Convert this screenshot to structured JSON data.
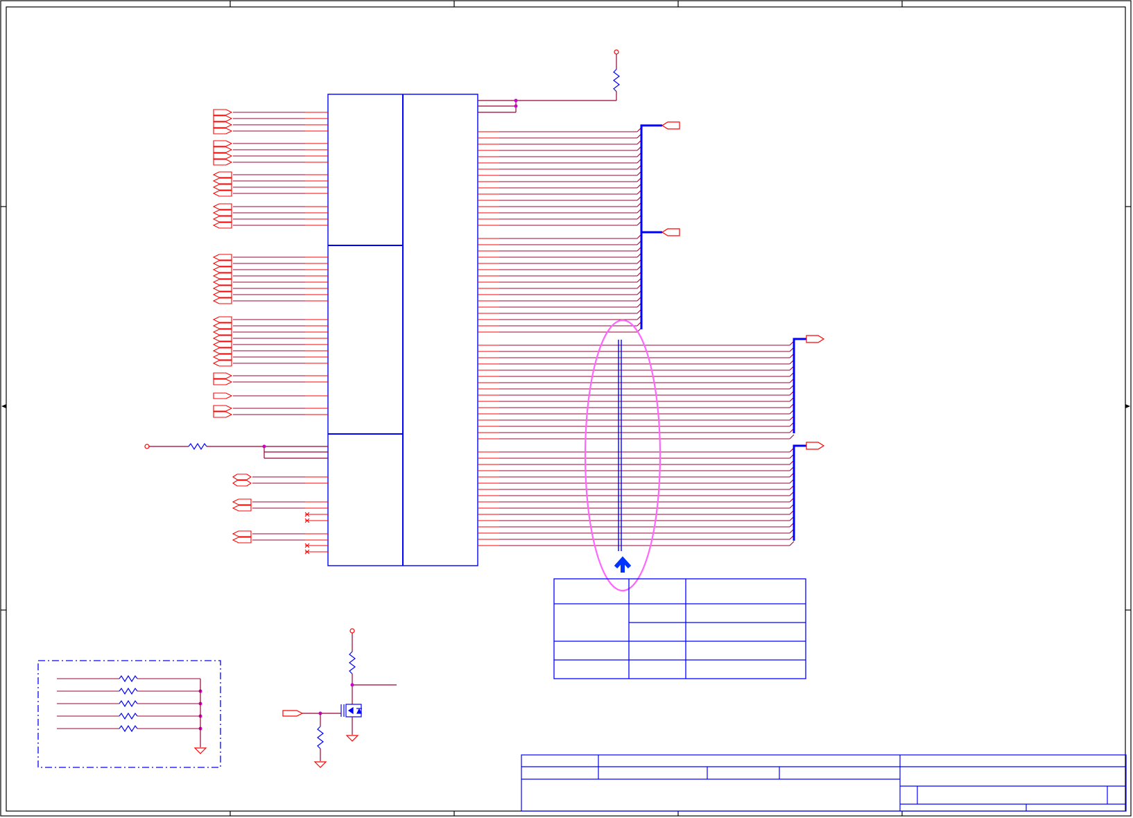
{
  "sheet": {
    "text_labels": []
  },
  "colors": {
    "border": "#000000",
    "part": "#0000ff",
    "wire": "#990033",
    "port": "#ff0000",
    "junction": "#cc00cc",
    "highlight": "#ff66ff",
    "arrow": "#0033ff",
    "bus": "#0000ff"
  },
  "icons": {
    "port": "offsheet-connector-icon",
    "power": "power-port-icon",
    "ground": "ground-icon",
    "resistor": "resistor-icon",
    "mosfet": "mosfet-icon",
    "no_connect": "no-connect-icon",
    "callout": "up-arrow-icon"
  }
}
